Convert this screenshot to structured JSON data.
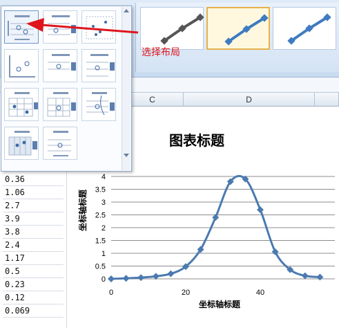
{
  "annotation": {
    "label": "选择布局",
    "color": "#e0141c"
  },
  "sheet": {
    "columns": [
      {
        "id": "C",
        "label": "C"
      },
      {
        "id": "D",
        "label": "D"
      }
    ],
    "cells": [
      "0.36",
      "1.06",
      "2.7",
      "3.9",
      "3.8",
      "2.4",
      "1.17",
      "0.5",
      "0.23",
      "0.12",
      "0.069"
    ]
  },
  "chart_data": {
    "type": "line",
    "title": "图表标题",
    "xlabel": "坐标轴标题",
    "ylabel": "坐标轴标题",
    "x_ticks": [
      "0",
      "20",
      "40"
    ],
    "y_ticks": [
      "0",
      "0.5",
      "1",
      "1.5",
      "2",
      "2.5",
      "3",
      "3.5",
      "4"
    ],
    "xlim": [
      0,
      60
    ],
    "ylim": [
      0,
      4
    ],
    "grid": true,
    "color": "#4a7ab0",
    "x": [
      0,
      4,
      8,
      12,
      16,
      20,
      24,
      28,
      32,
      36,
      40,
      44,
      48,
      52,
      56
    ],
    "y": [
      0,
      0.02,
      0.05,
      0.1,
      0.2,
      0.48,
      1.15,
      2.4,
      3.8,
      3.9,
      2.7,
      1.06,
      0.36,
      0.12,
      0.069
    ]
  },
  "icons": {
    "layout_thumb_count": 11,
    "style_thumb_count": 3
  }
}
